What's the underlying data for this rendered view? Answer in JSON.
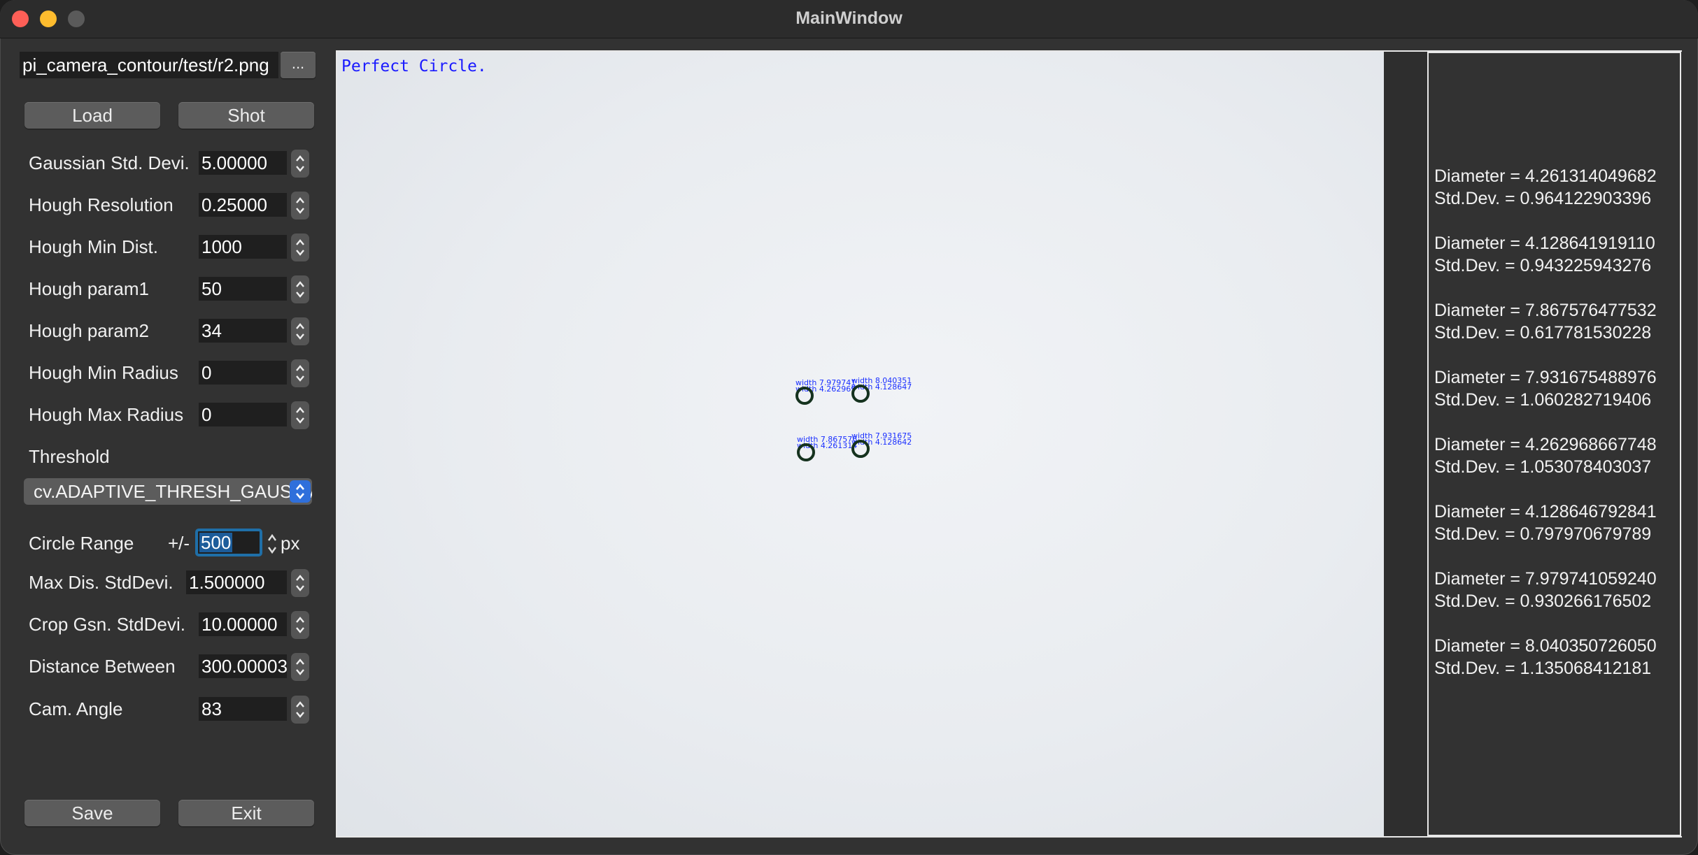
{
  "window": {
    "title": "MainWindow"
  },
  "file": {
    "path": "pi_camera_contour/test/r2.png",
    "browse_label": "..."
  },
  "buttons": {
    "load": "Load",
    "shot": "Shot",
    "save": "Save",
    "exit": "Exit"
  },
  "params": [
    {
      "label": "Gaussian Std. Devi.",
      "value": "5.00000"
    },
    {
      "label": "Hough Resolution",
      "value": "0.25000"
    },
    {
      "label": "Hough Min Dist.",
      "value": "1000"
    },
    {
      "label": "Hough param1",
      "value": "50"
    },
    {
      "label": "Hough param2",
      "value": "34"
    },
    {
      "label": "Hough Min Radius",
      "value": "0"
    },
    {
      "label": "Hough Max Radius",
      "value": "0"
    }
  ],
  "threshold": {
    "label": "Threshold",
    "selected": "cv.ADAPTIVE_THRESH_GAUSSIAN_C"
  },
  "circle_range": {
    "label": "Circle Range",
    "prefix": "+/-",
    "value": "500",
    "unit": "px"
  },
  "params2": [
    {
      "label": "Max Dis. StdDevi.",
      "value": "1.500000"
    },
    {
      "label": "Crop Gsn. StdDevi.",
      "value": "10.00000"
    },
    {
      "label": "Distance Between",
      "value": "300.00003"
    },
    {
      "label": "Cam. Angle",
      "value": "83"
    }
  ],
  "image": {
    "overlay": "Perfect Circle.",
    "labels": [
      {
        "a": "width 7.979741",
        "b": "width 4.262969"
      },
      {
        "a": "width 8.040351",
        "b": "width 4.128647"
      },
      {
        "a": "width 7.867576",
        "b": "width 4.261314"
      },
      {
        "a": "width 7.931675",
        "b": "width 4.128642"
      }
    ]
  },
  "results": [
    {
      "diameter": "Diameter = 4.261314049682",
      "stddev": "Std.Dev. = 0.964122903396"
    },
    {
      "diameter": "Diameter = 4.128641919110",
      "stddev": "Std.Dev. = 0.943225943276"
    },
    {
      "diameter": "Diameter = 7.867576477532",
      "stddev": "Std.Dev. = 0.617781530228"
    },
    {
      "diameter": "Diameter = 7.931675488976",
      "stddev": "Std.Dev. = 1.060282719406"
    },
    {
      "diameter": "Diameter = 4.262968667748",
      "stddev": "Std.Dev. = 1.053078403037"
    },
    {
      "diameter": "Diameter = 4.128646792841",
      "stddev": "Std.Dev. = 0.797970679789"
    },
    {
      "diameter": "Diameter = 7.979741059240",
      "stddev": "Std.Dev. = 0.930266176502"
    },
    {
      "diameter": "Diameter = 8.040350726050",
      "stddev": "Std.Dev. = 1.135068412181"
    }
  ]
}
